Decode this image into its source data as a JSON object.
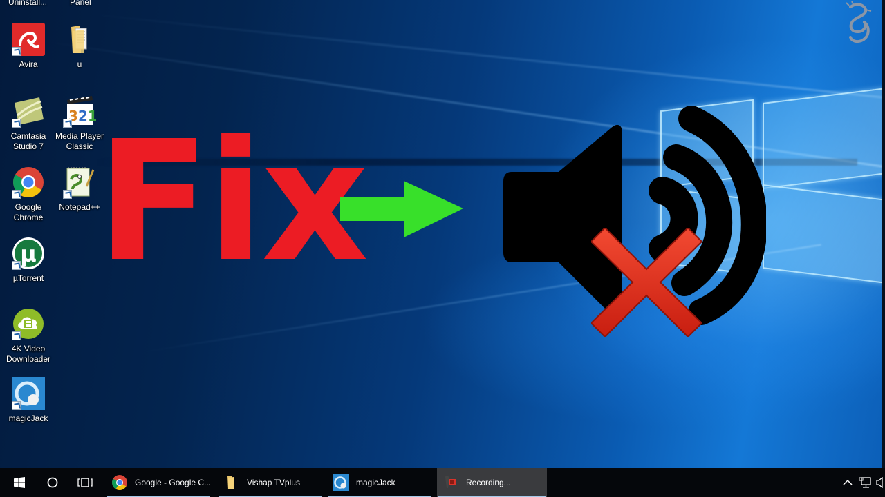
{
  "desktop": {
    "partial_top_labels": [
      "Uninstall...",
      "Panel"
    ],
    "icons": [
      {
        "label_lines": [
          "Avira"
        ],
        "icon": "avira-umbrella-icon"
      },
      {
        "label_lines": [
          "u"
        ],
        "icon": "folder-documents-icon"
      },
      {
        "label_lines": [
          "Camtasia",
          "Studio 7"
        ],
        "icon": "camtasia-icon"
      },
      {
        "label_lines": [
          "Media Player",
          "Classic"
        ],
        "icon": "media-player-classic-icon"
      },
      {
        "label_lines": [
          "Google",
          "Chrome"
        ],
        "icon": "chrome-icon"
      },
      {
        "label_lines": [
          "Notepad++"
        ],
        "icon": "notepad-plus-plus-icon"
      },
      {
        "label_lines": [
          "µTorrent"
        ],
        "icon": "utorrent-icon"
      },
      {
        "label_lines": [
          "4K Video",
          "Downloader"
        ],
        "icon": "4k-video-downloader-icon"
      },
      {
        "label_lines": [
          "magicJack"
        ],
        "icon": "magicjack-icon"
      }
    ],
    "corner_logo": "dragon-logo-icon"
  },
  "overlay": {
    "headline": "Fix",
    "arrow": "right-arrow-icon",
    "symbol": "speaker-muted-icon",
    "colors": {
      "headline": "#ec1c24",
      "arrow": "#38e02a",
      "speaker": "#000000",
      "cross": "#e8321e"
    }
  },
  "taskbar": {
    "start": "windows-start-icon",
    "search": "cortana-circle-icon",
    "task_view": "task-view-icon",
    "apps": [
      {
        "label": "Google - Google C...",
        "icon": "chrome-icon",
        "active": false
      },
      {
        "label": "Vishap TVplus",
        "icon": "folder-icon",
        "active": false
      },
      {
        "label": "magicJack",
        "icon": "magicjack-icon",
        "active": false
      },
      {
        "label": "Recording...",
        "icon": "recorder-icon",
        "active": true
      }
    ],
    "tray": [
      "chevron-up-icon",
      "network-icon",
      "volume-icon"
    ]
  }
}
